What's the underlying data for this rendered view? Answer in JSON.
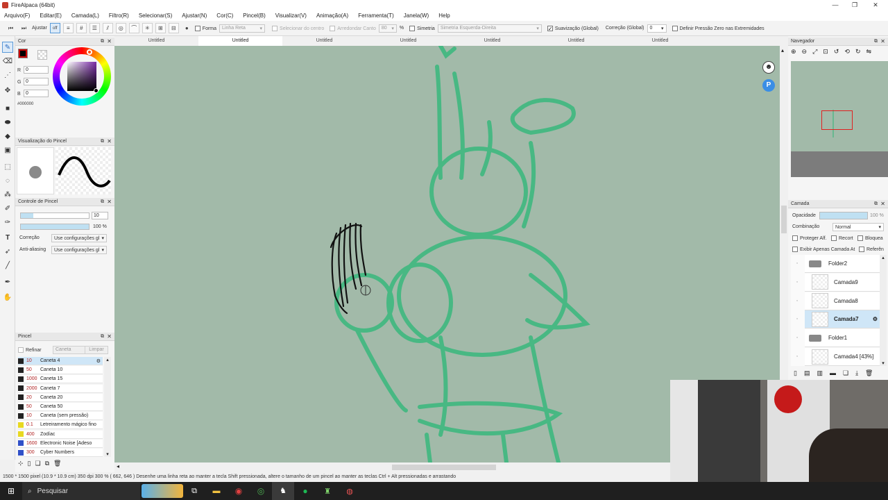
{
  "window": {
    "title": "FireAlpaca (64bit)"
  },
  "menu": [
    "Arquivo(F)",
    "Editar(E)",
    "Camada(L)",
    "Filtro(R)",
    "Selecionar(S)",
    "Ajustar(N)",
    "Cor(C)",
    "Pincel(B)",
    "Visualizar(V)",
    "Animação(A)",
    "Ferramenta(T)",
    "Janela(W)",
    "Help"
  ],
  "toolbar": {
    "adjust": "Ajustar",
    "off_label": "off",
    "form": "Forma",
    "form_value": "Linha Reta",
    "select_center": "Selecionar do centro",
    "round_corner": "Arredondar Canto",
    "round_value": "80",
    "percent": "%",
    "symmetry": "Simetria",
    "symmetry_value": "Simetria Esquerda-Direita",
    "smoothing": "Suavização (Global)",
    "correction": "Correção (Global)",
    "correction_value": "0",
    "zero_pressure": "Definir Pressão Zero nas Extremidades"
  },
  "tabs": [
    "Untitled",
    "Untitled",
    "Untitled",
    "Untitled",
    "Untitled",
    "Untitled",
    "Untitled"
  ],
  "color_panel": {
    "title": "Cor",
    "r_label": "R",
    "g_label": "G",
    "b_label": "B",
    "r": "0",
    "g": "0",
    "b": "0",
    "hex": "#000000",
    "fg": "#000000"
  },
  "brush_preview": {
    "title": "Visualização do Pincel"
  },
  "brush_control": {
    "title": "Controle de Pincel",
    "size": "10",
    "opacity": "100 %",
    "correction_label": "Correção",
    "correction_value": "Use configurações gl",
    "antialias_label": "Anti-aliasing",
    "antialias_value": "Use configurações gl"
  },
  "brush_panel": {
    "title": "Pincel",
    "refine": "Refinar",
    "search_placeholder": "Caneta",
    "clear": "Limpar",
    "items": [
      {
        "size": "10",
        "name": "Caneta 4",
        "color": "#222222",
        "selected": true
      },
      {
        "size": "50",
        "name": "Caneta 10",
        "color": "#222222"
      },
      {
        "size": "1000",
        "name": "Caneta 15",
        "color": "#222222"
      },
      {
        "size": "2000",
        "name": "Caneta 7",
        "color": "#222222"
      },
      {
        "size": "20",
        "name": "Caneta 20",
        "color": "#222222"
      },
      {
        "size": "50",
        "name": "Caneta 50",
        "color": "#222222"
      },
      {
        "size": "10",
        "name": "Caneta (sem pressão)",
        "color": "#222222"
      },
      {
        "size": "0.1",
        "name": "Letreiramento mágico fino",
        "color": "#e8d820"
      },
      {
        "size": "400",
        "name": "Zodíac",
        "color": "#e8d820"
      },
      {
        "size": "1600",
        "name": "Electronic Noise [Adeso",
        "color": "#3050c8"
      },
      {
        "size": "300",
        "name": "Cyber Numbers",
        "color": "#3050c8"
      }
    ]
  },
  "navigator": {
    "title": "Navegador"
  },
  "layers": {
    "title": "Camada",
    "opacity_label": "Opacidade",
    "opacity": "100 %",
    "blend_label": "Combinação",
    "blend": "Normal",
    "protect": "Proteger Alf.",
    "clip": "Recort",
    "lock": "Bloquea",
    "show_only": "Exibir Apenas Camada At",
    "ref": "Referên",
    "items": [
      {
        "name": "Folder2",
        "type": "folder"
      },
      {
        "name": "Camada9",
        "type": "layer"
      },
      {
        "name": "Camada8",
        "type": "layer"
      },
      {
        "name": "Camada7",
        "type": "layer",
        "selected": true
      },
      {
        "name": "Folder1",
        "type": "folder"
      },
      {
        "name": "Camada4 [43%]",
        "type": "layer"
      }
    ]
  },
  "status": {
    "text": "1500 * 1500 pixel  (10.9 * 10.9 cm)  350 dpi  300 %  ( 662, 646 )  Desenhe uma linha reta ao manter a tecla Shift pressionada, altere o tamanho de um pincel ao manter as teclas Ctrl + Alt pressionadas e arrastando"
  },
  "taskbar": {
    "search": "Pesquisar"
  },
  "colors": {
    "canvas": "#a2baa9",
    "sketch": "#3fb87f",
    "accent": "#3a8ee6"
  }
}
